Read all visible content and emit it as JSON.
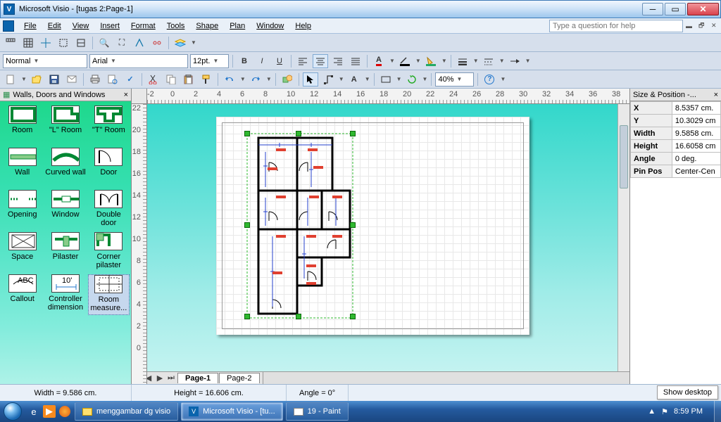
{
  "titlebar": {
    "title": "Microsoft Visio - [tugas 2:Page-1]"
  },
  "menu": {
    "items": [
      "File",
      "Edit",
      "View",
      "Insert",
      "Format",
      "Tools",
      "Shape",
      "Plan",
      "Window",
      "Help"
    ],
    "ask_placeholder": "Type a question for help"
  },
  "formatting": {
    "style": "Normal",
    "font": "Arial",
    "size": "12pt.",
    "zoom": "40%"
  },
  "shapes_panel": {
    "title": "Walls, Doors and Windows",
    "items": [
      "Room",
      "\"L\" Room",
      "\"T\" Room",
      "Wall",
      "Curved wall",
      "Door",
      "Opening",
      "Window",
      "Double door",
      "Space",
      "Pilaster",
      "Corner pilaster",
      "Callout",
      "Controller dimension",
      "Room measure..."
    ],
    "selected_index": 14
  },
  "ruler": {
    "h": [
      "-2",
      "0",
      "2",
      "4",
      "6",
      "8",
      "10",
      "12",
      "14",
      "16",
      "18",
      "20",
      "22",
      "24",
      "26",
      "28",
      "30",
      "32",
      "34",
      "36",
      "38"
    ],
    "v": [
      "22",
      "20",
      "18",
      "16",
      "14",
      "12",
      "10",
      "8",
      "6",
      "4",
      "2",
      "0"
    ]
  },
  "page_tabs": {
    "tabs": [
      "Page-1",
      "Page-2"
    ],
    "active": 0
  },
  "size_position": {
    "title": "Size & Position -...",
    "rows": [
      {
        "k": "X",
        "v": "8.5357 cm."
      },
      {
        "k": "Y",
        "v": "10.3029 cm"
      },
      {
        "k": "Width",
        "v": "9.5858 cm."
      },
      {
        "k": "Height",
        "v": "16.6058 cm"
      },
      {
        "k": "Angle",
        "v": "0 deg."
      },
      {
        "k": "Pin Pos",
        "v": "Center-Cen"
      }
    ]
  },
  "status": {
    "width": "Width = 9.586 cm.",
    "height": "Height = 16.606 cm.",
    "angle": "Angle = 0°",
    "show_desktop": "Show desktop"
  },
  "taskbar": {
    "buttons": [
      {
        "label": "menggambar dg visio",
        "icon": "folder",
        "active": false
      },
      {
        "label": "Microsoft Visio - [tu...",
        "icon": "visio",
        "active": true
      },
      {
        "label": "19 - Paint",
        "icon": "paint",
        "active": false
      }
    ],
    "time": "8:59 PM"
  }
}
